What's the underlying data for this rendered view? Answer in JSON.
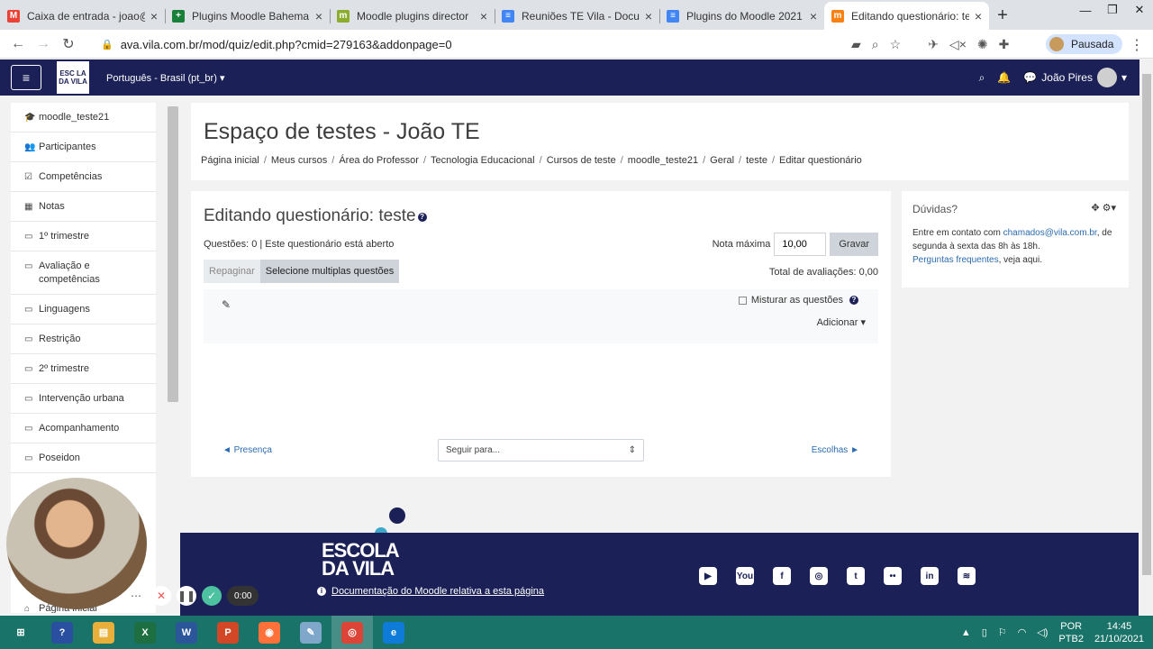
{
  "browser": {
    "tabs": [
      {
        "title": "Caixa de entrada - joao@",
        "icon": "gmail-icon",
        "color": "#ea4335",
        "glyph": "M"
      },
      {
        "title": "Plugins Moodle Bahema",
        "icon": "sheets-icon",
        "color": "#188038",
        "glyph": "+"
      },
      {
        "title": "Moodle plugins director",
        "icon": "moodle-icon",
        "color": "#8bac2c",
        "glyph": "m"
      },
      {
        "title": "Reuniões TE Vila - Docum",
        "icon": "docs-icon",
        "color": "#4285f4",
        "glyph": "≡"
      },
      {
        "title": "Plugins do Moodle 2021",
        "icon": "docs-icon",
        "color": "#4285f4",
        "glyph": "≡"
      },
      {
        "title": "Editando questionário: te",
        "icon": "moodle-icon",
        "color": "#f98012",
        "glyph": "m"
      }
    ],
    "url": "ava.vila.com.br/mod/quiz/edit.php?cmid=279163&addonpage=0",
    "profile_label": "Pausada"
  },
  "navbar": {
    "logo_line1": "ESC LA",
    "logo_line2": "DA VILA",
    "language": "Português - Brasil (pt_br)",
    "user_name": "João Pires"
  },
  "drawer": {
    "items": [
      {
        "label": "moodle_teste21",
        "icon": "graduation-cap-icon",
        "glyph": "🎓"
      },
      {
        "label": "Participantes",
        "icon": "users-icon",
        "glyph": "👥"
      },
      {
        "label": "Competências",
        "icon": "checkbox-icon",
        "glyph": "☑"
      },
      {
        "label": "Notas",
        "icon": "table-icon",
        "glyph": "▦"
      },
      {
        "label": "1º trimestre",
        "icon": "folder-icon",
        "glyph": "▭"
      },
      {
        "label": "Avaliação e competências",
        "icon": "folder-icon",
        "glyph": "▭"
      },
      {
        "label": "Linguagens",
        "icon": "folder-icon",
        "glyph": "▭"
      },
      {
        "label": "Restrição",
        "icon": "folder-icon",
        "glyph": "▭"
      },
      {
        "label": "2º trimestre",
        "icon": "folder-icon",
        "glyph": "▭"
      },
      {
        "label": "Intervenção urbana",
        "icon": "folder-icon",
        "glyph": "▭"
      },
      {
        "label": "Acompanhamento",
        "icon": "folder-icon",
        "glyph": "▭"
      },
      {
        "label": "Poseidon",
        "icon": "folder-icon",
        "glyph": "▭"
      }
    ],
    "bottom_item": "Página inicial"
  },
  "header": {
    "title": "Espaço de testes - João TE",
    "breadcrumb": [
      "Página inicial",
      "Meus cursos",
      "Área do Professor",
      "Tecnologia Educacional",
      "Cursos de teste",
      "moodle_teste21",
      "Geral",
      "teste",
      "Editar questionário"
    ]
  },
  "quiz": {
    "title": "Editando questionário: teste",
    "info": "Questões: 0 | Este questionário está aberto",
    "repaginate": "Repaginar",
    "select_multiple": "Selecione multiplas questões",
    "max_grade_label": "Nota máxima",
    "max_grade_value": "10,00",
    "save": "Gravar",
    "total_grades": "Total de avaliações: 0,00",
    "shuffle": "Misturar as questões",
    "add": "Adicionar",
    "prev_link": "◄ Presença",
    "jump_placeholder": "Seguir para...",
    "next_link": "Escolhas ►"
  },
  "side_block": {
    "title": "Dúvidas?",
    "text_before": "Entre em contato com ",
    "email": "chamados@vila.com.br",
    "text_mid": ", de segunda à sexta das 8h às 18h.",
    "faq_link": "Perguntas frequentes",
    "text_after": ", veja aqui."
  },
  "footer": {
    "logo_line1": "ESCOLA",
    "logo_line2": "DA VILA",
    "doc_link": "Documentação do Moodle relativa a esta página",
    "social": [
      {
        "icon": "youtube-icon",
        "glyph": "▶"
      },
      {
        "icon": "youtube-icon",
        "glyph": "You"
      },
      {
        "icon": "facebook-icon",
        "glyph": "f"
      },
      {
        "icon": "instagram-icon",
        "glyph": "◎"
      },
      {
        "icon": "twitter-icon",
        "glyph": "t"
      },
      {
        "icon": "flickr-icon",
        "glyph": "••"
      },
      {
        "icon": "linkedin-icon",
        "glyph": "in"
      },
      {
        "icon": "spotify-icon",
        "glyph": "≋"
      }
    ]
  },
  "recording": {
    "time": "0:00"
  },
  "taskbar": {
    "apps": [
      {
        "icon": "windows-start-icon",
        "color": "#1a7368",
        "glyph": "⊞"
      },
      {
        "icon": "help-icon",
        "color": "#2a4fa0",
        "glyph": "?"
      },
      {
        "icon": "file-explorer-icon",
        "color": "#e8b03a",
        "glyph": "▤"
      },
      {
        "icon": "excel-icon",
        "color": "#1d6f42",
        "glyph": "X"
      },
      {
        "icon": "word-icon",
        "color": "#2b579a",
        "glyph": "W"
      },
      {
        "icon": "powerpoint-icon",
        "color": "#d24726",
        "glyph": "P"
      },
      {
        "icon": "firefox-icon",
        "color": "#ff7139",
        "glyph": "◉"
      },
      {
        "icon": "notes-icon",
        "color": "#7fa7c9",
        "glyph": "✎"
      },
      {
        "icon": "chrome-icon",
        "color": "#db4437",
        "glyph": "◎"
      },
      {
        "icon": "edge-icon",
        "color": "#0f7bd8",
        "glyph": "e"
      }
    ],
    "lang_top": "POR",
    "lang_bottom": "PTB2",
    "time": "14:45",
    "date": "21/10/2021"
  }
}
